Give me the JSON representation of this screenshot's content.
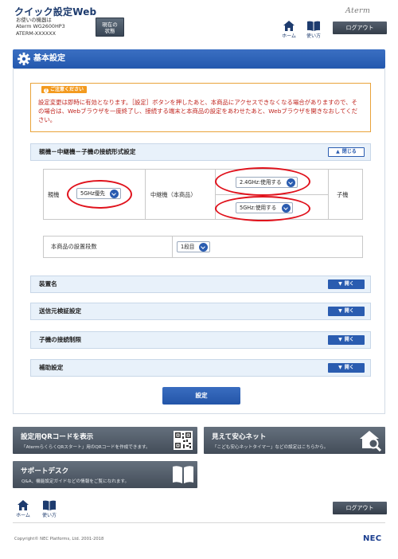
{
  "header": {
    "app_title": "クイック設定Web",
    "device_caption": "お使いの機器は",
    "device_model": "Aterm WG2600HP3",
    "device_ssid": "ATERM-XXXXXX",
    "status_button_line1": "現在の",
    "status_button_line2": "状態",
    "brand": "Aterm",
    "home_label": "ホーム",
    "help_label": "使い方",
    "logout_label": "ログアウト"
  },
  "page_title": "基本設定",
  "notice": {
    "tag": "ご注意ください",
    "text": "設定変更は即時に有効となります。［設定］ボタンを押したあと、本商品にアクセスできなくなる場合がありますので、その場合は、Webブラウザを一度終了し、接続する端末と本商品の設定をあわせたあと、Webブラウザを開きなおしてください。"
  },
  "connection_section": {
    "title": "親機－中継機－子機の接続形式設定",
    "toggle_label": "閉じる",
    "parent_label": "親機",
    "parent_value": "5GHz優先",
    "repeater_label": "中継機（本商品）",
    "band_24_value": "2.4GHz:使用する",
    "band_5_value": "5GHz:使用する",
    "child_label": "子機"
  },
  "placement": {
    "label": "本商品の設置段数",
    "value": "1段目"
  },
  "collapsed_sections": [
    {
      "title": "装置名",
      "toggle_label": "開く"
    },
    {
      "title": "送信元検証設定",
      "toggle_label": "開く"
    },
    {
      "title": "子機の接続制限",
      "toggle_label": "開く"
    },
    {
      "title": "補助設定",
      "toggle_label": "開く"
    }
  ],
  "settings_button": "設定",
  "tiles": {
    "qr": {
      "title": "設定用QRコードを表示",
      "desc": "「AtermらくらくQRスタート」用のQRコードを作成できます。"
    },
    "safe_net": {
      "title": "見えて安心ネット",
      "desc": "「こども安心ネットタイマー」などの設定はこちらから。"
    },
    "support": {
      "title": "サポートデスク",
      "desc": "Q&A、機能設定ガイドなどの情報をご覧になれます。"
    }
  },
  "footer": {
    "home_label": "ホーム",
    "help_label": "使い方",
    "logout_label": "ログアウト",
    "copyright": "Copyright© NEC Platforms, Ltd. 2001-2018",
    "company_logo": "NEC"
  },
  "colors": {
    "primary_blue": "#2a5cb0",
    "notice_orange": "#f39a1e",
    "notice_red_text": "#c0251f",
    "highlight_ring": "#e0121c",
    "tile_gray": "#4f5965"
  },
  "icons": [
    "gear-icon",
    "home-icon",
    "book-icon",
    "chevron-up-icon",
    "chevron-down-icon",
    "qr-code-icon",
    "house-search-icon",
    "open-book-icon"
  ]
}
